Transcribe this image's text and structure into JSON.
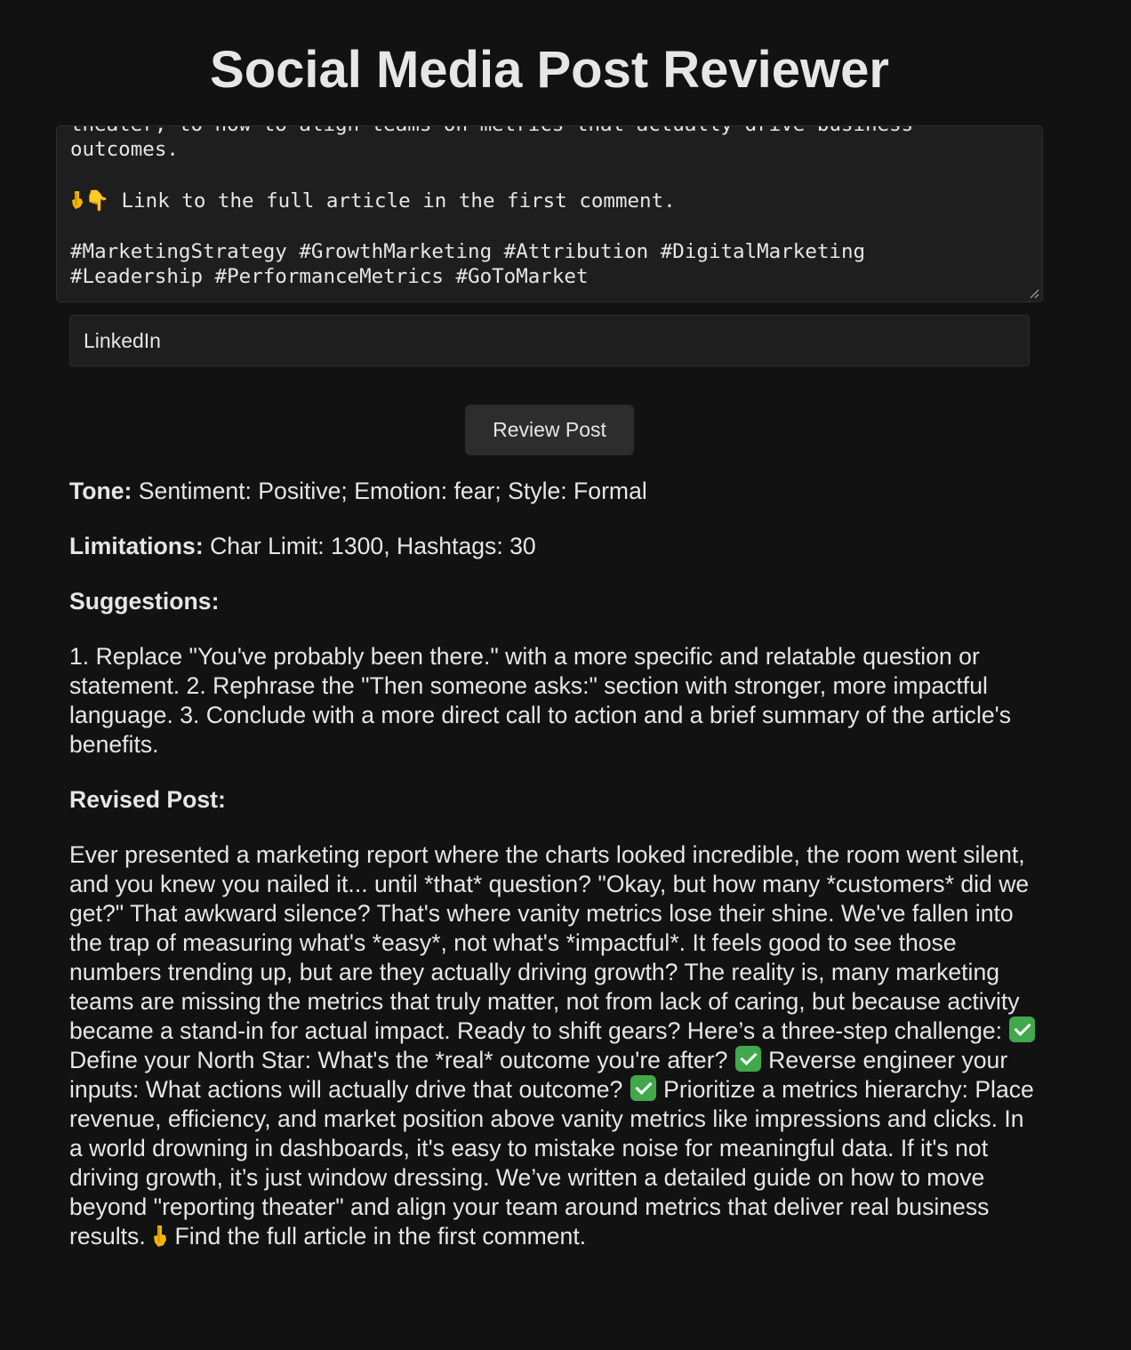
{
  "page": {
    "title": "Social Media Post Reviewer"
  },
  "post_input": {
    "value_visible_lines": [
      "theater, to how to align teams on metrics that actually drive business",
      "outcomes.",
      "",
      "👇 Link to the full article in the first comment.",
      "",
      "#MarketingStrategy #GrowthMarketing #Attribution #DigitalMarketing",
      "#Leadership #PerformanceMetrics #GoToMarket"
    ]
  },
  "platform_input": {
    "value": "LinkedIn"
  },
  "review_button": {
    "label": "Review Post"
  },
  "results": {
    "tone_label": "Tone:",
    "tone_value": "Sentiment: Positive; Emotion: fear; Style: Formal",
    "limitations_label": "Limitations:",
    "limitations_value": "Char Limit: 1300, Hashtags: 30",
    "suggestions_label": "Suggestions:",
    "suggestions_text": "1. Replace \"You've probably been there.\" with a more specific and relatable question or statement. 2. Rephrase the \"Then someone asks:\" section with stronger, more impactful language. 3. Conclude with a more direct call to action and a brief summary of the article's benefits.",
    "revised_label": "Revised Post:",
    "revised_part1": "Ever presented a marketing report where the charts looked incredible, the room went silent, and you knew you nailed it... until *that* question? \"Okay, but how many *customers* did we get?\" That awkward silence? That's where vanity metrics lose their shine. We've fallen into the trap of measuring what's *easy*, not what's *impactful*. It feels good to see those numbers trending up, but are they actually driving growth? The reality is, many marketing teams are missing the metrics that truly matter, not from lack of caring, but because activity became a stand-in for actual impact. Ready to shift gears? Here’s a three-step challenge: ",
    "revised_part2": " Define your North Star: What's the *real* outcome you're after? ",
    "revised_part3": " Reverse engineer your inputs: What actions will actually drive that outcome? ",
    "revised_part4": " Prioritize a metrics hierarchy: Place revenue, efficiency, and market position above vanity metrics like impressions and clicks. In a world drowning in dashboards, it's easy to mistake noise for meaningful data. If it's not driving growth, it’s just window dressing. We’ve written a detailed guide on how to move beyond \"reporting theater\" and align your team around metrics that deliver real business results. ",
    "revised_part5": " Find the full article in the first comment."
  },
  "icons": {
    "check_emoji": "check-mark-button-icon",
    "point_down_emoji": "backhand-index-pointing-down-icon",
    "check_color": "#41a84c",
    "point_color": "#f4b400"
  }
}
